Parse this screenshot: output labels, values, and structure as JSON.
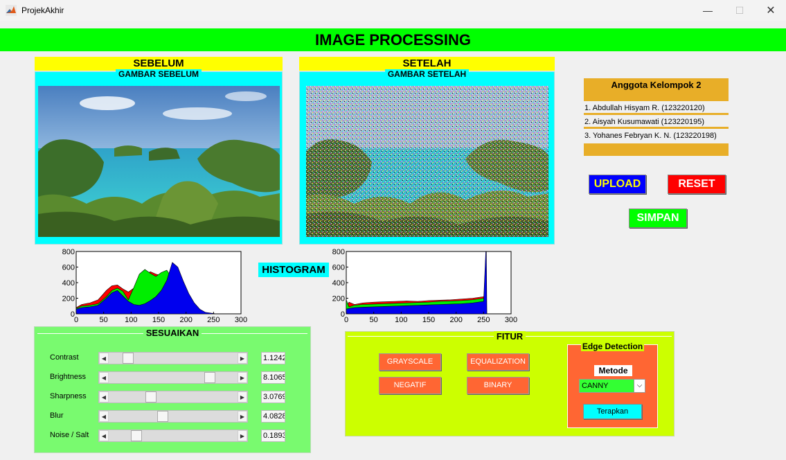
{
  "window": {
    "title": "ProjekAkhir",
    "minimize": "—",
    "maximize": "☐",
    "close": "✕"
  },
  "header": {
    "title": "IMAGE PROCESSING"
  },
  "before": {
    "label": "SEBELUM",
    "panel_title": "GAMBAR SEBELUM"
  },
  "after": {
    "label": "SETELAH",
    "panel_title": "GAMBAR SETELAH"
  },
  "members": {
    "title": "Anggota Kelompok 2",
    "items": [
      "1. Abdullah Hisyam R. (123220120)",
      "2. Aisyah Kusumawati (123220195)",
      "3. Yohanes Febryan K. N. (123220198)"
    ]
  },
  "buttons": {
    "upload": "UPLOAD",
    "reset": "RESET",
    "simpan": "SIMPAN"
  },
  "histogram_label": "HISTOGRAM",
  "adjust": {
    "title": "SESUAIKAN",
    "sliders": [
      {
        "label": "Contrast",
        "value": "1.1242",
        "level": 0.12
      },
      {
        "label": "Brightness",
        "value": "8.1065",
        "level": 0.81
      },
      {
        "label": "Sharpness",
        "value": "3.0769",
        "level": 0.31
      },
      {
        "label": "Blur",
        "value": "4.0828",
        "level": 0.41
      },
      {
        "label": "Noise / Salt",
        "value": "0.1893",
        "level": 0.19
      }
    ]
  },
  "features": {
    "title": "FITUR",
    "grayscale": "GRAYSCALE",
    "equalization": "EQUALIZATION",
    "negatif": "NEGATIF",
    "binary": "BINARY",
    "edge": {
      "title": "Edge Detection",
      "method_label": "Metode",
      "method_value": "CANNY",
      "apply": "Terapkan"
    }
  },
  "colors": {
    "header": "#00ff00",
    "label_bg": "#ffff00",
    "panel_bg": "#00ffff",
    "members_bg": "#e8ae28",
    "upload": "#0000ff",
    "reset": "#ff0000",
    "simpan": "#00ff00",
    "adjust_bg": "#79fa6f",
    "features_bg": "#ccff00",
    "orange_btn": "#ff6633"
  },
  "chart_data": [
    {
      "type": "area",
      "title": "",
      "x_ticks": [
        0,
        50,
        100,
        150,
        200,
        250,
        300
      ],
      "y_ticks": [
        0,
        200,
        400,
        600,
        800
      ],
      "xlim": [
        0,
        300
      ],
      "ylim": [
        0,
        800
      ],
      "series": [
        {
          "color": "#ff0000",
          "x": [
            0,
            10,
            25,
            40,
            55,
            65,
            75,
            85,
            95,
            105,
            115,
            125,
            135,
            145,
            155,
            165,
            175,
            185,
            195,
            205,
            215,
            225,
            235,
            245,
            255
          ],
          "y": [
            80,
            120,
            140,
            180,
            300,
            360,
            370,
            320,
            280,
            330,
            420,
            500,
            540,
            510,
            490,
            430,
            360,
            300,
            220,
            160,
            90,
            40,
            15,
            5,
            0
          ]
        },
        {
          "color": "#00ee00",
          "x": [
            0,
            10,
            25,
            40,
            55,
            65,
            75,
            85,
            95,
            105,
            115,
            125,
            135,
            145,
            155,
            165,
            175,
            185,
            195,
            205,
            215,
            225,
            235,
            245,
            255
          ],
          "y": [
            70,
            100,
            110,
            130,
            220,
            300,
            330,
            290,
            180,
            340,
            510,
            570,
            520,
            480,
            530,
            560,
            450,
            330,
            230,
            150,
            80,
            35,
            10,
            5,
            0
          ]
        },
        {
          "color": "#0000ee",
          "x": [
            0,
            10,
            25,
            40,
            55,
            65,
            75,
            85,
            95,
            105,
            115,
            125,
            135,
            145,
            155,
            165,
            175,
            185,
            195,
            205,
            215,
            225,
            235,
            245,
            255
          ],
          "y": [
            60,
            80,
            90,
            110,
            200,
            270,
            300,
            230,
            160,
            120,
            110,
            130,
            170,
            220,
            300,
            430,
            660,
            600,
            420,
            260,
            140,
            60,
            20,
            10,
            0
          ]
        }
      ]
    },
    {
      "type": "area",
      "title": "",
      "x_ticks": [
        0,
        50,
        100,
        150,
        200,
        250,
        300
      ],
      "y_ticks": [
        0,
        200,
        400,
        600,
        800
      ],
      "xlim": [
        0,
        300
      ],
      "ylim": [
        0,
        800
      ],
      "series": [
        {
          "color": "#ff0000",
          "x": [
            0,
            5,
            15,
            30,
            50,
            70,
            90,
            110,
            130,
            150,
            170,
            190,
            210,
            230,
            250,
            254,
            255
          ],
          "y": [
            90,
            150,
            120,
            140,
            150,
            155,
            160,
            165,
            160,
            170,
            175,
            180,
            190,
            200,
            220,
            250,
            0
          ]
        },
        {
          "color": "#00ee00",
          "x": [
            0,
            5,
            15,
            30,
            50,
            70,
            90,
            110,
            130,
            150,
            170,
            190,
            210,
            230,
            250,
            254,
            255
          ],
          "y": [
            180,
            90,
            110,
            120,
            125,
            130,
            135,
            140,
            145,
            150,
            160,
            165,
            170,
            180,
            200,
            230,
            0
          ]
        },
        {
          "color": "#0000ee",
          "x": [
            0,
            5,
            15,
            30,
            50,
            70,
            90,
            110,
            130,
            150,
            170,
            190,
            210,
            230,
            250,
            254,
            255,
            256
          ],
          "y": [
            60,
            70,
            80,
            85,
            90,
            95,
            100,
            105,
            110,
            115,
            120,
            125,
            130,
            140,
            160,
            800,
            800,
            0
          ]
        }
      ]
    }
  ]
}
